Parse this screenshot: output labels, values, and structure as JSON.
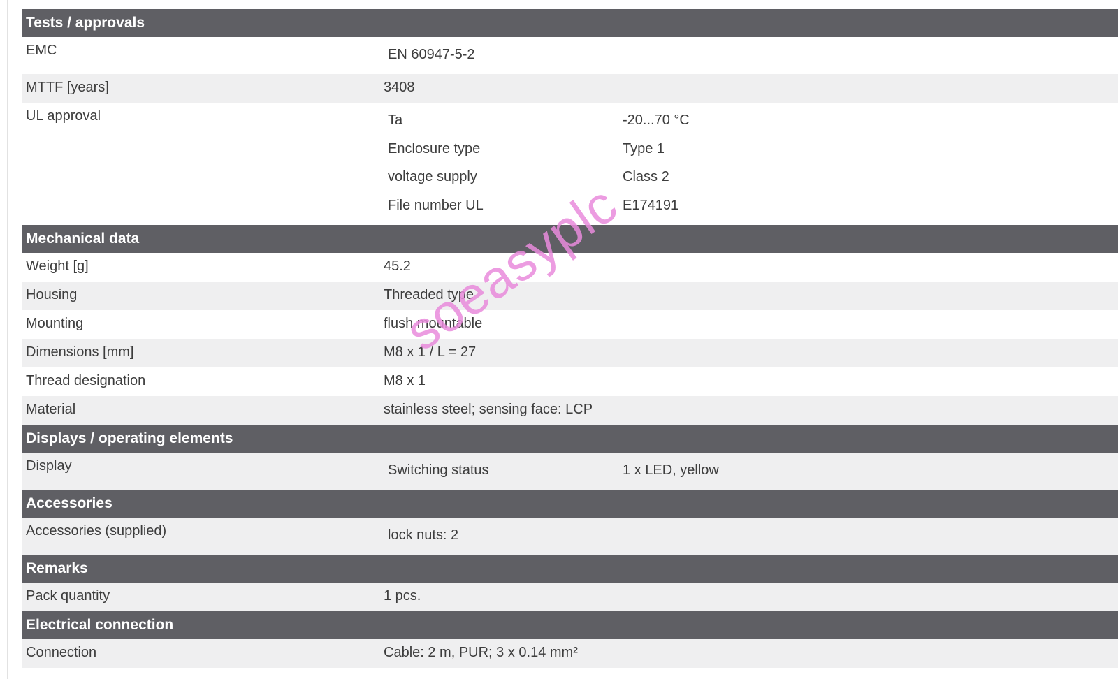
{
  "sections": {
    "tests": {
      "title": "Tests / approvals",
      "emc": {
        "label": "EMC",
        "value": "EN 60947-5-2"
      },
      "mttf": {
        "label": "MTTF [years]",
        "value": "3408"
      },
      "ul": {
        "label": "UL approval",
        "rows": [
          {
            "key": "Ta",
            "value": "-20...70 °C"
          },
          {
            "key": "Enclosure type",
            "value": "Type 1"
          },
          {
            "key": "voltage supply",
            "value": "Class 2"
          },
          {
            "key": "File number UL",
            "value": "E174191"
          }
        ]
      }
    },
    "mechanical": {
      "title": "Mechanical data",
      "rows": [
        {
          "label": "Weight [g]",
          "value": "45.2"
        },
        {
          "label": "Housing",
          "value": "Threaded type"
        },
        {
          "label": "Mounting",
          "value": "flush mountable"
        },
        {
          "label": "Dimensions [mm]",
          "value": "M8 x 1 / L = 27"
        },
        {
          "label": "Thread designation",
          "value": "M8 x 1"
        },
        {
          "label": "Material",
          "value": "stainless steel; sensing face: LCP"
        }
      ]
    },
    "displays": {
      "title": "Displays / operating elements",
      "display": {
        "label": "Display",
        "key": "Switching status",
        "value": "1 x LED, yellow"
      }
    },
    "accessories": {
      "title": "Accessories",
      "row": {
        "label": "Accessories (supplied)",
        "value": "lock nuts: 2"
      }
    },
    "remarks": {
      "title": "Remarks",
      "row": {
        "label": "Pack quantity",
        "value": "1 pcs."
      }
    },
    "electrical": {
      "title": "Electrical connection",
      "row": {
        "label": "Connection",
        "value": "Cable: 2 m, PUR; 3 x 0.14 mm²"
      }
    }
  },
  "watermark": "soeasyplc"
}
